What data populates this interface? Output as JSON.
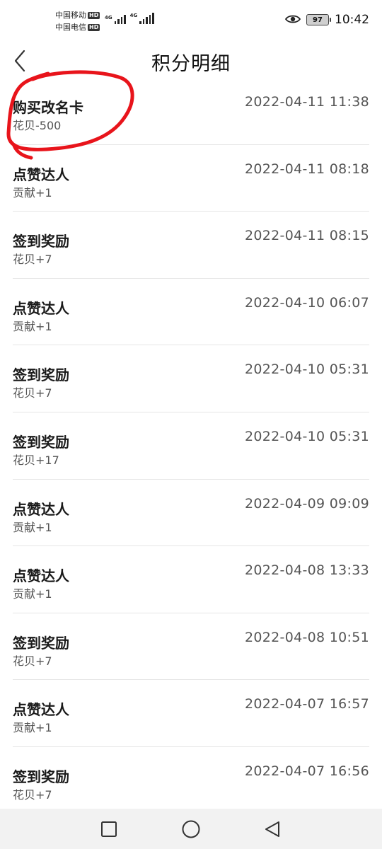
{
  "status_bar": {
    "carrier1": "中国移动",
    "carrier2": "中国电信",
    "hd_label": "HD",
    "net1": "4G",
    "net2": "4G",
    "battery": "97",
    "time": "10:42"
  },
  "header": {
    "title": "积分明细",
    "back_icon": "chevron-left-icon"
  },
  "records": [
    {
      "title": "购买改名卡",
      "detail": "花贝-500",
      "datetime": "2022-04-11 11:38"
    },
    {
      "title": "点赞达人",
      "detail": "贡献+1",
      "datetime": "2022-04-11 08:18"
    },
    {
      "title": "签到奖励",
      "detail": "花贝+7",
      "datetime": "2022-04-11 08:15"
    },
    {
      "title": "点赞达人",
      "detail": "贡献+1",
      "datetime": "2022-04-10 06:07"
    },
    {
      "title": "签到奖励",
      "detail": "花贝+7",
      "datetime": "2022-04-10 05:31"
    },
    {
      "title": "签到奖励",
      "detail": "花贝+17",
      "datetime": "2022-04-10 05:31"
    },
    {
      "title": "点赞达人",
      "detail": "贡献+1",
      "datetime": "2022-04-09 09:09"
    },
    {
      "title": "点赞达人",
      "detail": "贡献+1",
      "datetime": "2022-04-08 13:33"
    },
    {
      "title": "签到奖励",
      "detail": "花贝+7",
      "datetime": "2022-04-08 10:51"
    },
    {
      "title": "点赞达人",
      "detail": "贡献+1",
      "datetime": "2022-04-07 16:57"
    },
    {
      "title": "签到奖励",
      "detail": "花贝+7",
      "datetime": "2022-04-07 16:56"
    }
  ],
  "annotation_color": "#e8141b",
  "nav": {
    "recents_icon": "square-icon",
    "home_icon": "circle-icon",
    "back_icon": "triangle-back-icon"
  }
}
